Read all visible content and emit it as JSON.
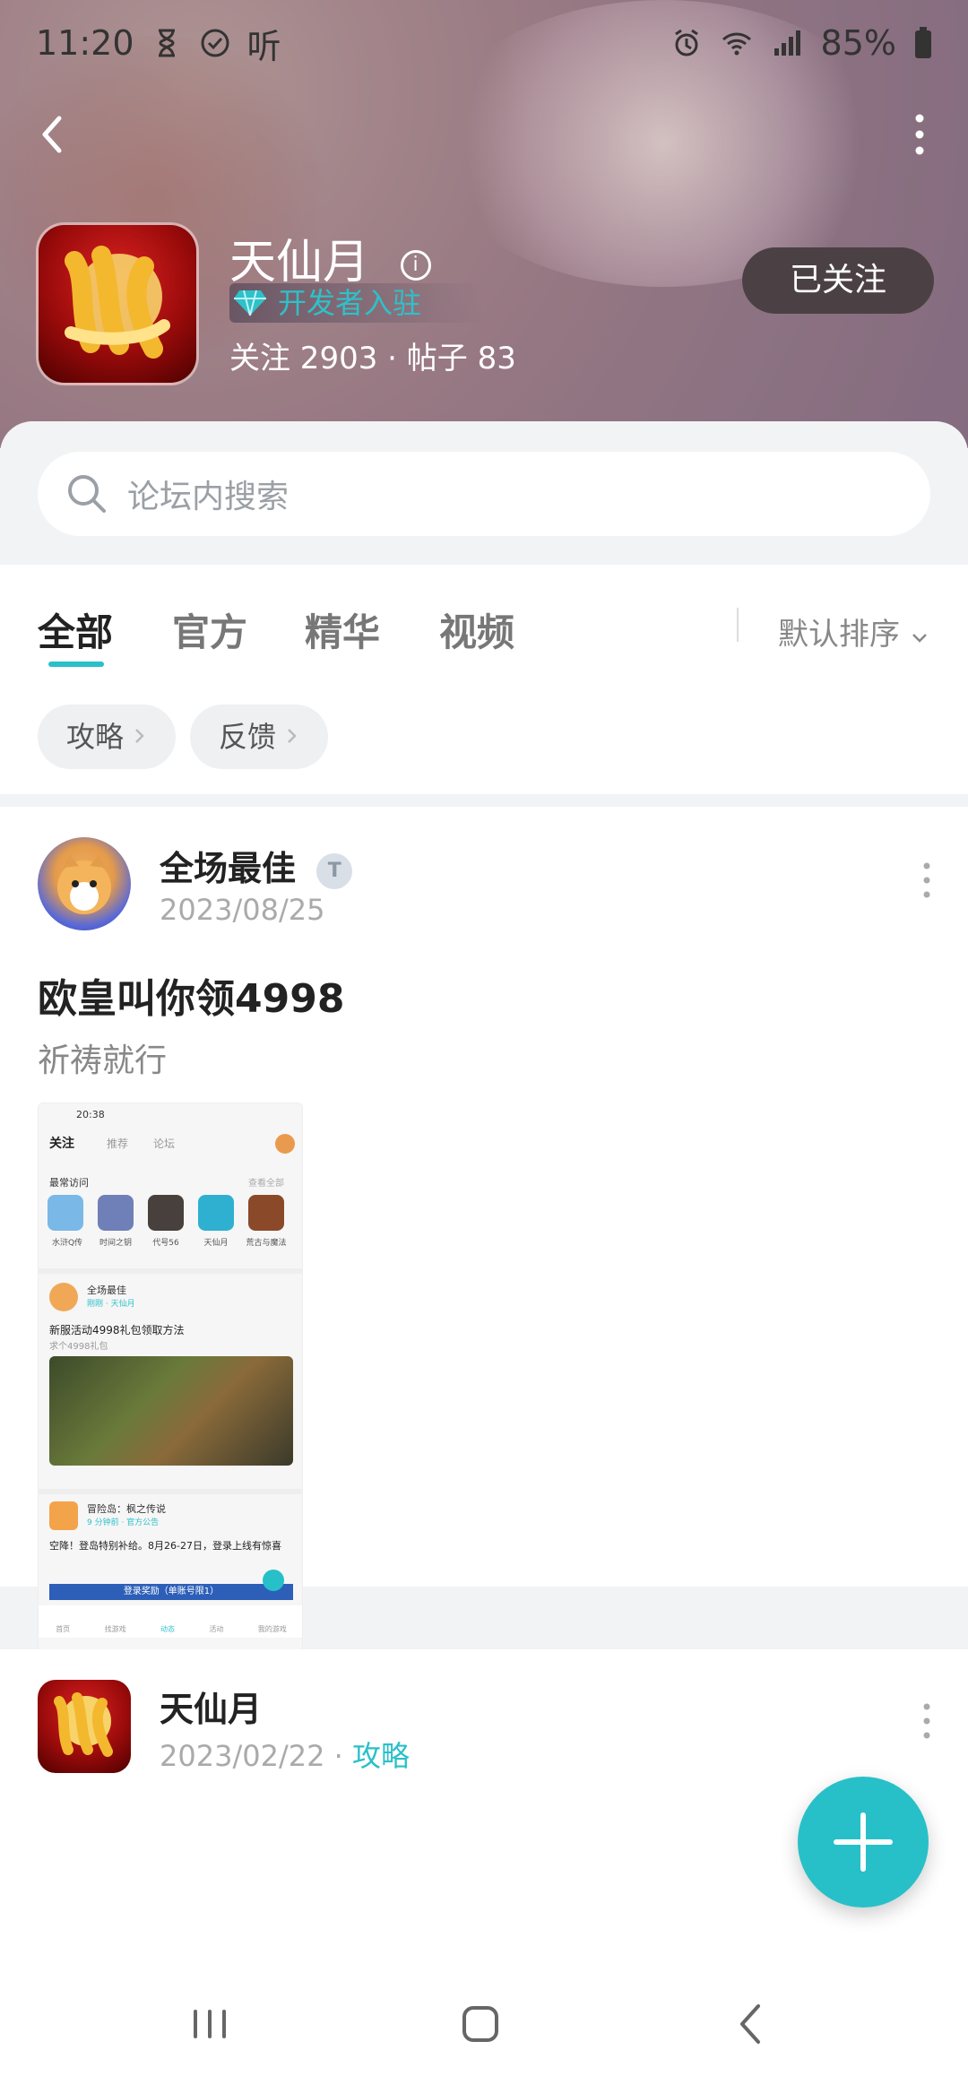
{
  "status": {
    "time": "11:20",
    "listen": "听",
    "battery": "85%"
  },
  "header": {
    "name": "天仙月",
    "dev_badge": "开发者入驻",
    "stats": "关注 2903 · 帖子 83",
    "follow_label": "已关注"
  },
  "search": {
    "placeholder": "论坛内搜索"
  },
  "tabs": [
    "全部",
    "官方",
    "精华",
    "视频"
  ],
  "sort_label": "默认排序",
  "chips": [
    "攻略",
    "反馈"
  ],
  "post": {
    "author": "全场最佳",
    "date": "2023/08/25",
    "title": "欧皇叫你领4998",
    "subtitle": "祈祷就行",
    "screenshot": {
      "time": "20:38",
      "tabs": [
        "关注",
        "推荐",
        "论坛"
      ],
      "recent_title": "最常访问",
      "recent_more": "查看全部",
      "games": [
        "水浒Q传",
        "时间之钥",
        "代号56",
        "天仙月",
        "荒古与魔法"
      ],
      "inner_author": "全场最佳",
      "inner_meta": "刚刚 · 天仙月",
      "inner_title": "新服活动4998礼包领取方法",
      "inner_sub": "求个4998礼包",
      "second_author": "冒险岛：枫之传说",
      "second_meta": "9 分钟前 · 官方公告",
      "second_text": "空降！登岛特别补给。8月26-27日，登录上线有惊喜",
      "banner": "登录奖励（单账号限1）",
      "bottom_tabs": [
        "首页",
        "找游戏",
        "动态",
        "活动",
        "我的游戏"
      ]
    }
  },
  "post2": {
    "author": "天仙月",
    "date": "2023/02/22",
    "tag": "攻略"
  }
}
